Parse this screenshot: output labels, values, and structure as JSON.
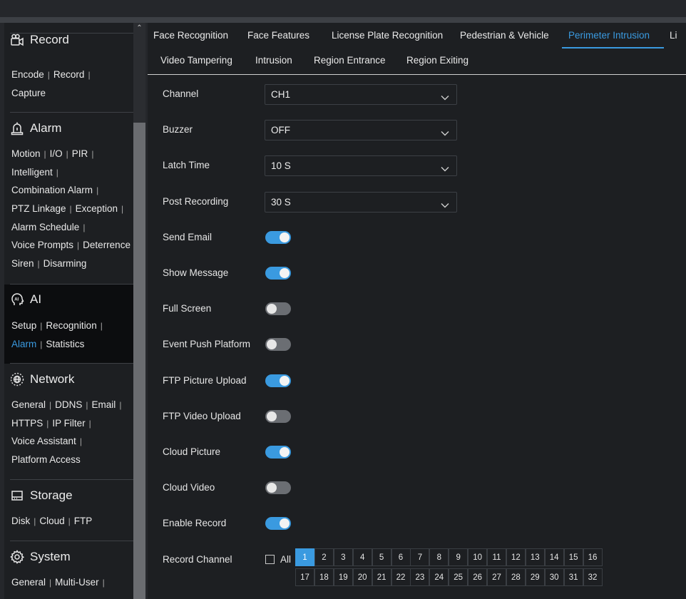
{
  "colors": {
    "accent": "#3a9ae0",
    "panel": "#1d1f22",
    "background": "#25272b"
  },
  "sidebar": {
    "sections": [
      {
        "title": "Record",
        "icon": "video-camera-icon",
        "links": [
          [
            "Encode",
            "Record"
          ],
          [
            "Capture"
          ]
        ]
      },
      {
        "title": "Alarm",
        "icon": "alarm-bell-icon",
        "links": [
          [
            "Motion",
            "I/O",
            "PIR"
          ],
          [
            "Intelligent"
          ],
          [
            "Combination Alarm"
          ],
          [
            "PTZ Linkage",
            "Exception"
          ],
          [
            "Alarm Schedule"
          ],
          [
            "Voice Prompts",
            "Deterrence"
          ],
          [
            "Siren",
            "Disarming"
          ]
        ]
      },
      {
        "title": "AI",
        "icon": "ai-head-icon",
        "links": [
          [
            "Setup",
            "Recognition"
          ],
          [
            "Alarm",
            "Statistics"
          ]
        ],
        "selected_link": "Alarm"
      },
      {
        "title": "Network",
        "icon": "globe-network-icon",
        "links": [
          [
            "General",
            "DDNS",
            "Email"
          ],
          [
            "HTTPS",
            "IP Filter"
          ],
          [
            "Voice Assistant"
          ],
          [
            "Platform Access"
          ]
        ]
      },
      {
        "title": "Storage",
        "icon": "hard-disk-icon",
        "links": [
          [
            "Disk",
            "Cloud",
            "FTP"
          ]
        ]
      },
      {
        "title": "System",
        "icon": "gear-icon",
        "links": [
          [
            "General",
            "Multi-User"
          ]
        ]
      }
    ]
  },
  "tabs_row1": [
    "Face Recognition",
    "Face Features",
    "License Plate Recognition",
    "Pedestrian & Vehicle",
    "Perimeter Intrusion",
    "Li"
  ],
  "tabs_row2": [
    "Video Tampering",
    "Intrusion",
    "Region Entrance",
    "Region Exiting"
  ],
  "active_tab": "Perimeter Intrusion",
  "form": {
    "selects": [
      {
        "label": "Channel",
        "value": "CH1"
      },
      {
        "label": "Buzzer",
        "value": "OFF"
      },
      {
        "label": "Latch Time",
        "value": "10 S"
      },
      {
        "label": "Post Recording",
        "value": "30 S"
      }
    ],
    "toggles": [
      {
        "label": "Send Email",
        "on": true
      },
      {
        "label": "Show Message",
        "on": true
      },
      {
        "label": "Full Screen",
        "on": false
      },
      {
        "label": "Event Push Platform",
        "on": false
      },
      {
        "label": "FTP Picture Upload",
        "on": true
      },
      {
        "label": "FTP Video Upload",
        "on": false
      },
      {
        "label": "Cloud Picture",
        "on": true
      },
      {
        "label": "Cloud Video",
        "on": false
      },
      {
        "label": "Enable Record",
        "on": true
      }
    ],
    "record_channel": {
      "label": "Record Channel",
      "all_label": "All",
      "all_checked": false,
      "channels": [
        "1",
        "2",
        "3",
        "4",
        "5",
        "6",
        "7",
        "8",
        "9",
        "10",
        "11",
        "12",
        "13",
        "14",
        "15",
        "16",
        "17",
        "18",
        "19",
        "20",
        "21",
        "22",
        "23",
        "24",
        "25",
        "26",
        "27",
        "28",
        "29",
        "30",
        "31",
        "32"
      ],
      "selected": [
        "1"
      ]
    }
  }
}
